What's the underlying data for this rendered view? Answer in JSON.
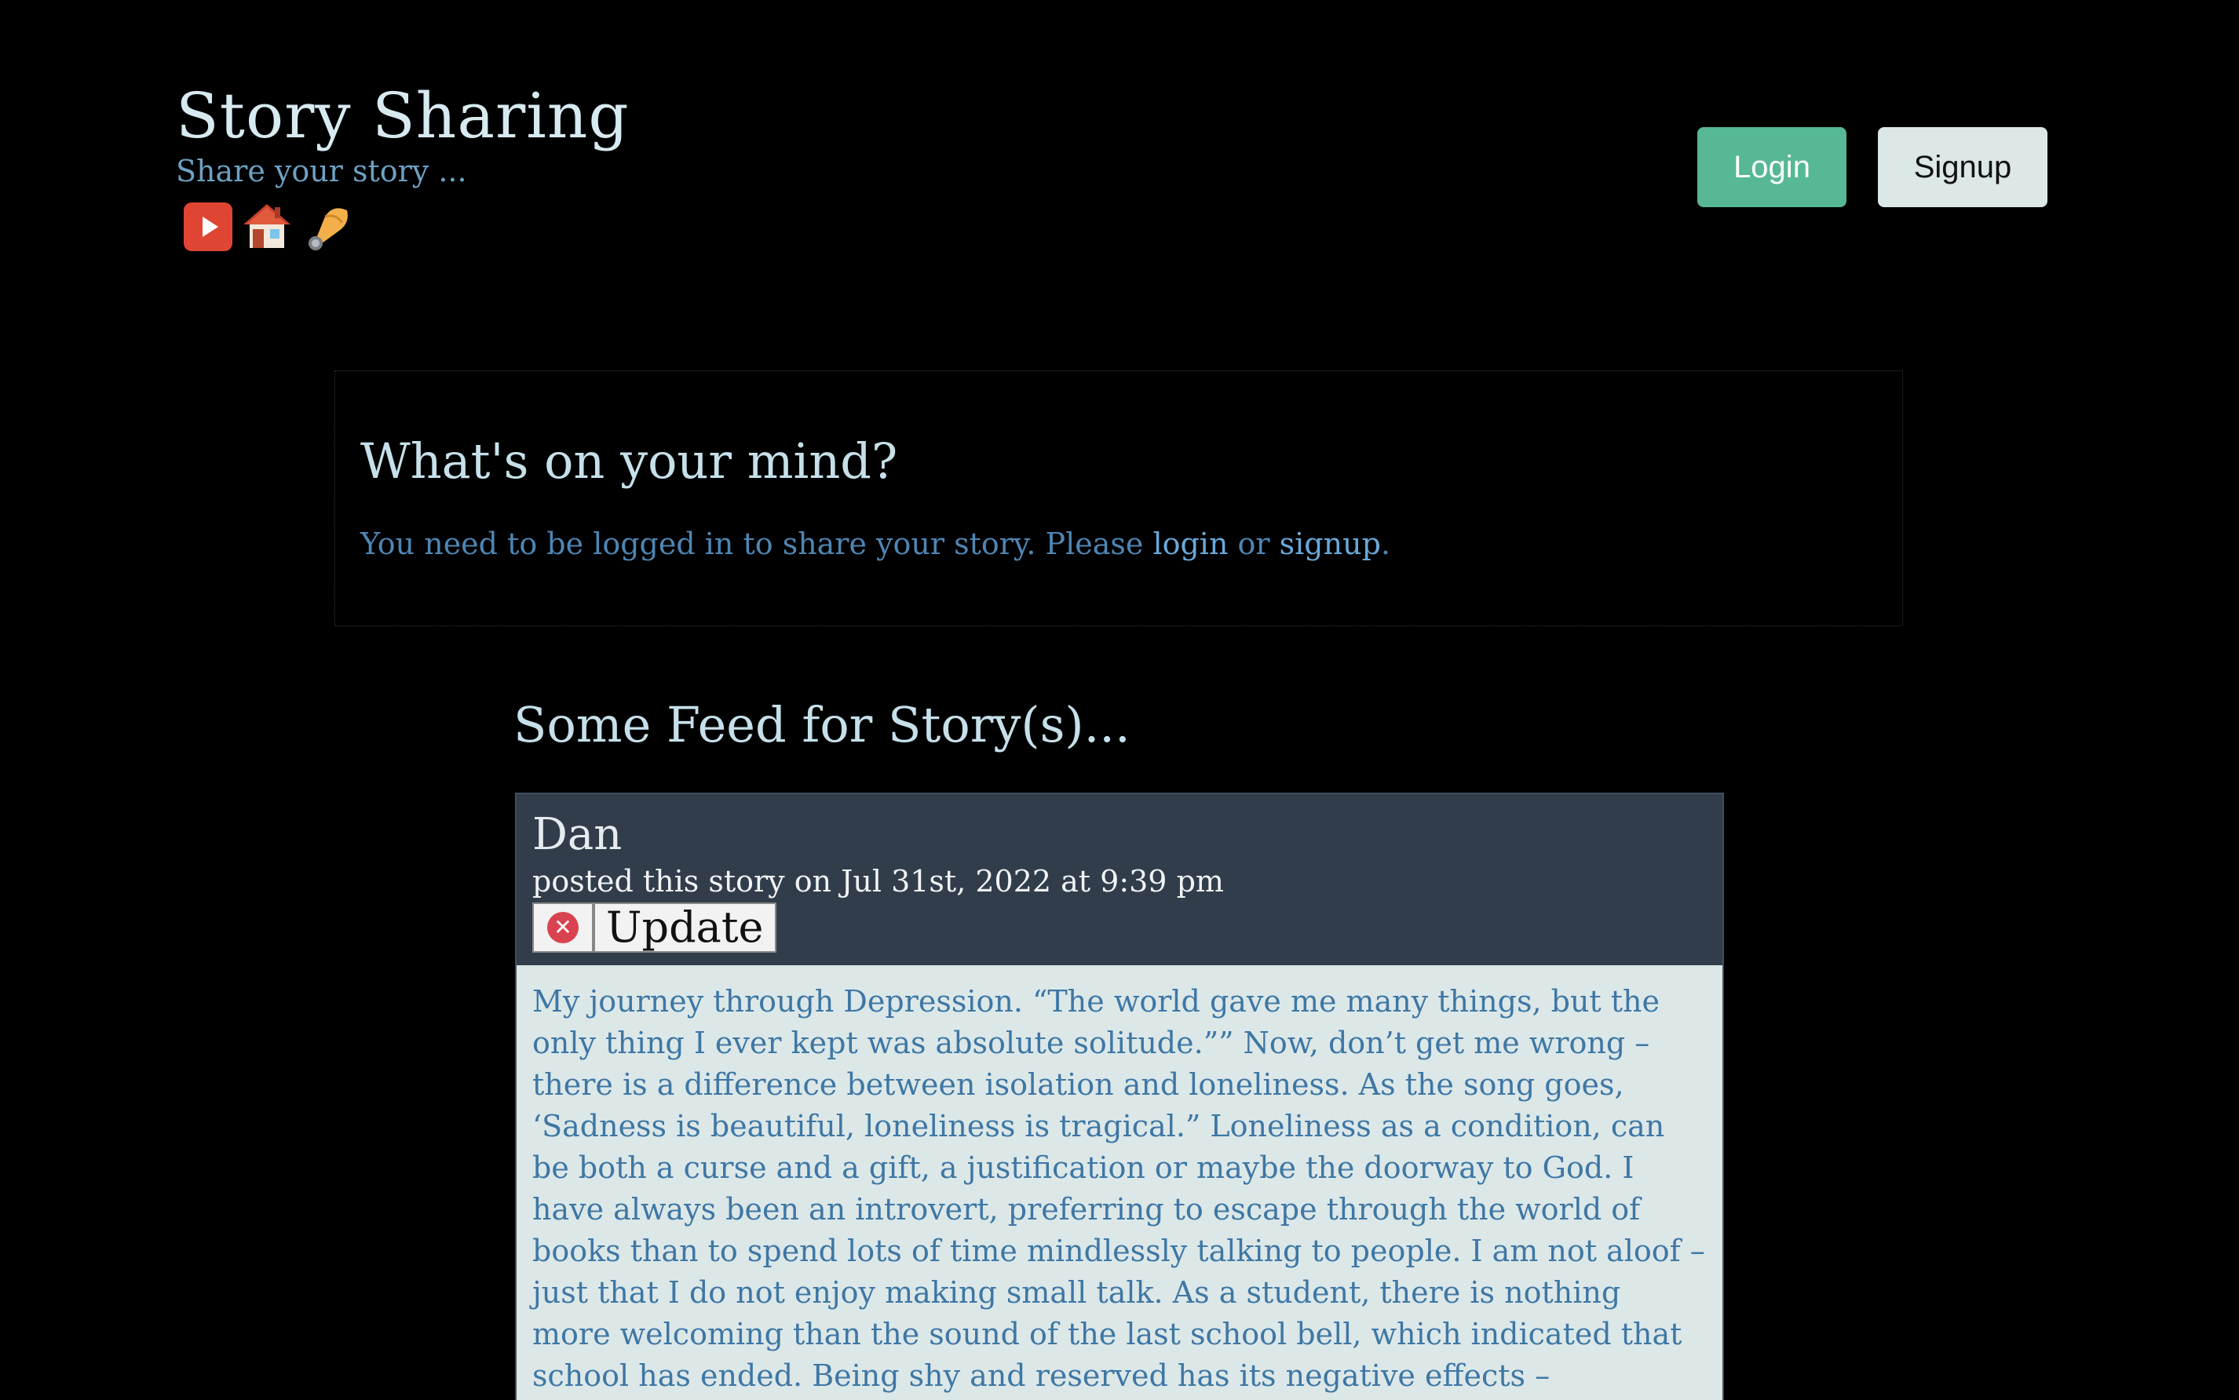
{
  "header": {
    "title": "Story Sharing",
    "tagline": "Share your story ...",
    "icons": [
      "youtube-play-icon",
      "house-icon",
      "writing-hand-icon"
    ]
  },
  "auth": {
    "login_label": "Login",
    "signup_label": "Signup"
  },
  "compose": {
    "title": "What's on your mind?",
    "message_prefix": "You need to be logged in to share your story. Please ",
    "login_link": "login",
    "or_text": " or ",
    "signup_link": "signup",
    "message_suffix": "."
  },
  "feed": {
    "title": "Some Feed for Story(s)...",
    "stories": [
      {
        "author": "Dan",
        "meta": "posted this story on Jul 31st, 2022 at 9:39 pm",
        "update_label": "Update",
        "delete_symbol": "✕",
        "body": "My journey through Depression. “The world gave me many things, but the only thing I ever kept was absolute solitude.”” Now, don’t get me wrong – there is a difference between isolation and loneliness. As the song goes, ‘Sadness is beautiful, loneliness is tragical.” Loneliness as a condition, can be both a curse and a gift, a justification or maybe the doorway to God. I have always been an introvert, preferring to escape through the world of books than to spend lots of time mindlessly talking to people. I am not aloof – just that I do not enjoy making small talk. As a student, there is nothing more welcoming than the sound of the last school bell, which indicated that school has ended. Being shy and reserved has its negative effects – somehow, I felt"
      }
    ]
  },
  "colors": {
    "background": "#000000",
    "login_button": "#56b894",
    "signup_button": "#dce7e8",
    "card_header": "#323d4c",
    "card_body": "#dce7e8",
    "link": "#6aa9da"
  }
}
